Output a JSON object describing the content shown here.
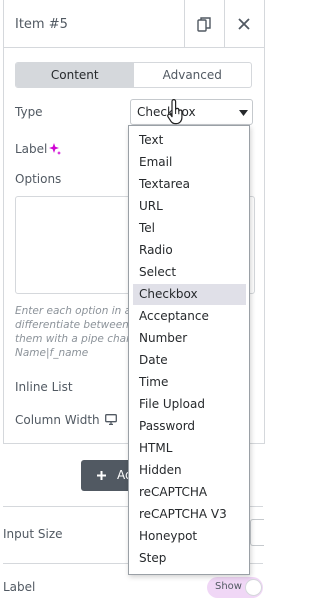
{
  "header": {
    "title": "Item #5"
  },
  "tabs": {
    "content": "Content",
    "advanced": "Advanced"
  },
  "fields": {
    "type_label": "Type",
    "type_value": "Checkbox",
    "label_label": "Label",
    "options_label": "Options",
    "options_help": [
      "Enter each option in a s",
      "differentiate between la",
      "them with a pipe char (",
      "Name|f_name"
    ],
    "inline_list_label": "Inline List",
    "column_width_label": "Column Width"
  },
  "add_button": {
    "label": "Ad"
  },
  "input_size": {
    "label": "Input Size"
  },
  "label_toggle": {
    "label": "Label",
    "toggle_text": "Show"
  },
  "dropdown": {
    "options": [
      "Text",
      "Email",
      "Textarea",
      "URL",
      "Tel",
      "Radio",
      "Select",
      "Checkbox",
      "Acceptance",
      "Number",
      "Date",
      "Time",
      "File Upload",
      "Password",
      "HTML",
      "Hidden",
      "reCAPTCHA",
      "reCAPTCHA V3",
      "Honeypot",
      "Step"
    ],
    "selected": "Checkbox"
  },
  "colors": {
    "accent": "#d004d4",
    "toggle_bg": "#f0d7f6",
    "button": "#515962"
  }
}
